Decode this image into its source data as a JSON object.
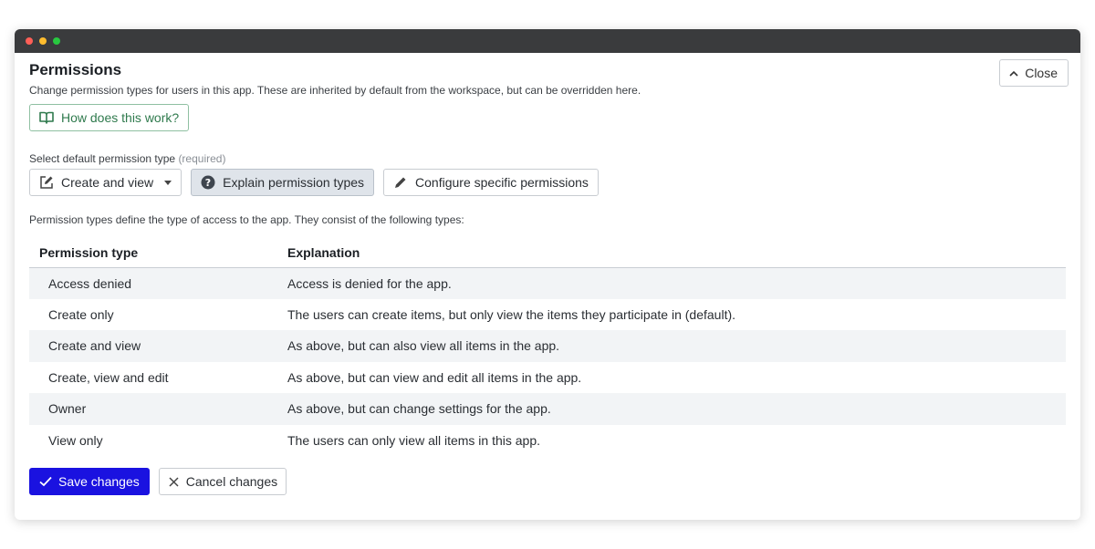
{
  "window": {
    "controls": [
      {
        "name": "close",
        "color": "#ff5f57"
      },
      {
        "name": "minimize",
        "color": "#febc2e"
      },
      {
        "name": "maximize",
        "color": "#28c840"
      }
    ]
  },
  "header": {
    "title": "Permissions",
    "close_label": "Close",
    "description": "Change permission types for users in this app. These are inherited by default from the workspace, but can be overridden here.",
    "help_label": "How does this work?"
  },
  "selector": {
    "label": "Select default permission type",
    "required_label": "(required)",
    "selected_value": "Create and view",
    "explain_label": "Explain permission types",
    "configure_label": "Configure specific permissions"
  },
  "table": {
    "intro": "Permission types define the type of access to the app. They consist of the following types:",
    "headers": [
      "Permission type",
      "Explanation"
    ],
    "rows": [
      {
        "type": "Access denied",
        "explanation": "Access is denied for the app."
      },
      {
        "type": "Create only",
        "explanation": "The users can create items, but only view the items they participate in (default)."
      },
      {
        "type": "Create and view",
        "explanation": "As above, but can also view all items in the app."
      },
      {
        "type": "Create, view and edit",
        "explanation": "As above, but can view and edit all items in the app."
      },
      {
        "type": "Owner",
        "explanation": "As above, but can change settings for the app."
      },
      {
        "type": "View only",
        "explanation": "The users can only view all items in this app."
      }
    ]
  },
  "footer": {
    "save_label": "Save changes",
    "cancel_label": "Cancel changes"
  },
  "colors": {
    "accent": "#1a12e0",
    "help_green": "#2f7a4d",
    "titlebar": "#3a3b3d"
  },
  "icons": {
    "close": "chevron-up-icon",
    "help": "book-open-icon",
    "select": "edit-square-icon",
    "explain": "question-circle-icon",
    "configure": "pencil-icon",
    "save": "check-icon",
    "cancel": "x-icon"
  }
}
